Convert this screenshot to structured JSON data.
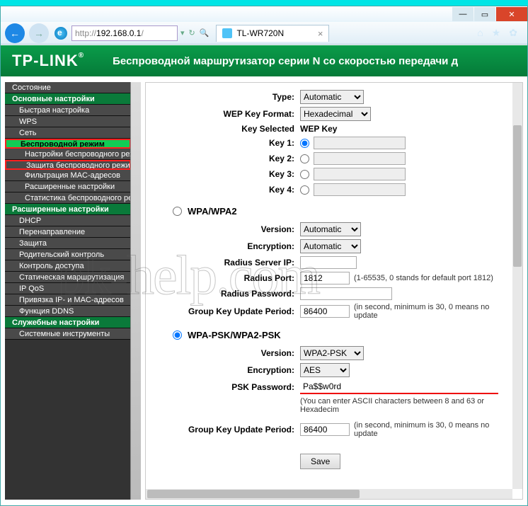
{
  "browser": {
    "url_proto": "http://",
    "url_host": "192.168.0.1",
    "url_path": "/",
    "tab_title": "TL-WR720N",
    "titlebar": {
      "min": "—",
      "max": "▭",
      "close": "✕"
    },
    "star1": "⌂",
    "star2": "★",
    "star3": "✿"
  },
  "banner": {
    "logo": "TP-LINK",
    "reg": "®",
    "title": "Беспроводной маршрутизатор серии N со скоростью передачи д"
  },
  "menu": {
    "status": "Состояние",
    "basic": "Основные настройки",
    "quick": "Быстрая настройка",
    "wps": "WPS",
    "net": "Сеть",
    "wireless": "Беспроводной режим",
    "w_settings": "Настройки беспроводного реж",
    "w_security": "Защита беспроводного режим",
    "w_mac": "Фильтрация MAC-адресов",
    "w_adv": "Расширенные настройки",
    "w_stat": "Статистика беспроводного ре",
    "adv": "Расширенные настройки",
    "dhcp": "DHCP",
    "fwd": "Перенаправление",
    "sec": "Защита",
    "parent": "Родительский контроль",
    "access": "Контроль доступа",
    "route": "Статическая маршрутизация",
    "qos": "IP QoS",
    "ipmac": "Привязка IP- и MAC-адресов",
    "ddns": "Функция DDNS",
    "svc": "Служебные настройки",
    "sys": "Системные инструменты"
  },
  "form": {
    "type_lbl": "Type:",
    "type_val": "Automatic",
    "wepfmt_lbl": "WEP Key Format:",
    "wepfmt_val": "Hexadecimal",
    "keysel_lbl": "Key Selected",
    "keysel_val": "WEP Key",
    "key1": "Key 1:",
    "key2": "Key 2:",
    "key3": "Key 3:",
    "key4": "Key 4:",
    "wpa_head": "WPA/WPA2",
    "version_lbl": "Version:",
    "version_val": "Automatic",
    "enc_lbl": "Encryption:",
    "enc_val": "Automatic",
    "radius_ip_lbl": "Radius Server IP:",
    "radius_port_lbl": "Radius Port:",
    "radius_port_val": "1812",
    "radius_port_note": "(1-65535, 0 stands for default port 1812)",
    "radius_pw_lbl": "Radius Password:",
    "gkup_lbl": "Group Key Update Period:",
    "gkup_val": "86400",
    "gkup_note": "(in second, minimum is 30, 0 means no update",
    "psk_head": "WPA-PSK/WPA2-PSK",
    "psk_version_val": "WPA2-PSK",
    "psk_enc_val": "AES",
    "psk_pw_lbl": "PSK Password:",
    "psk_pw_val": "Pa$$w0rd",
    "psk_note": "(You can enter ASCII characters between 8 and 63 or Hexadecim",
    "save": "Save"
  },
  "watermark": "pk-help.com"
}
